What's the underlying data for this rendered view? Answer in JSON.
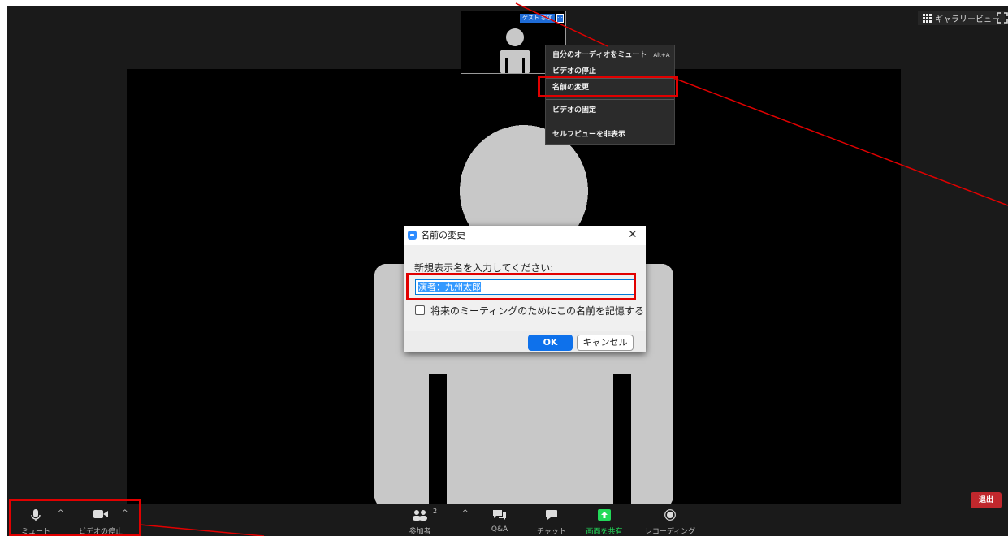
{
  "top_bar": {
    "gallery_view_label": "ギャラリービュー"
  },
  "self_view": {
    "name_tag": "ゲスト 参加",
    "more_label": "···"
  },
  "context_menu": {
    "items": [
      {
        "label": "自分のオーディオをミュート",
        "hotkey": "Alt+A"
      },
      {
        "label": "ビデオの停止"
      },
      {
        "label": "名前の変更"
      },
      {
        "label": "ビデオの固定"
      },
      {
        "label": "セルフビューを非表示"
      }
    ]
  },
  "rename_dialog": {
    "title": "名前の変更",
    "prompt": "新規表示名を入力してください:",
    "input_value": "演者：九州太郎",
    "remember_label": "将来のミーティングのためにこの名前を記憶する",
    "remember_checked": false,
    "ok_label": "OK",
    "cancel_label": "キャンセル"
  },
  "toolbar": {
    "mute_label": "ミュート",
    "video_label": "ビデオの停止",
    "participants_label": "参加者",
    "participants_count": "2",
    "qa_label": "Q&A",
    "chat_label": "チャット",
    "share_label": "画面を共有",
    "record_label": "レコーディング",
    "leave_label": "退出"
  },
  "colors": {
    "annotation": "#e10000",
    "share_green": "#23d959",
    "leave_red": "#c0282d",
    "ok_blue": "#0e71eb"
  }
}
